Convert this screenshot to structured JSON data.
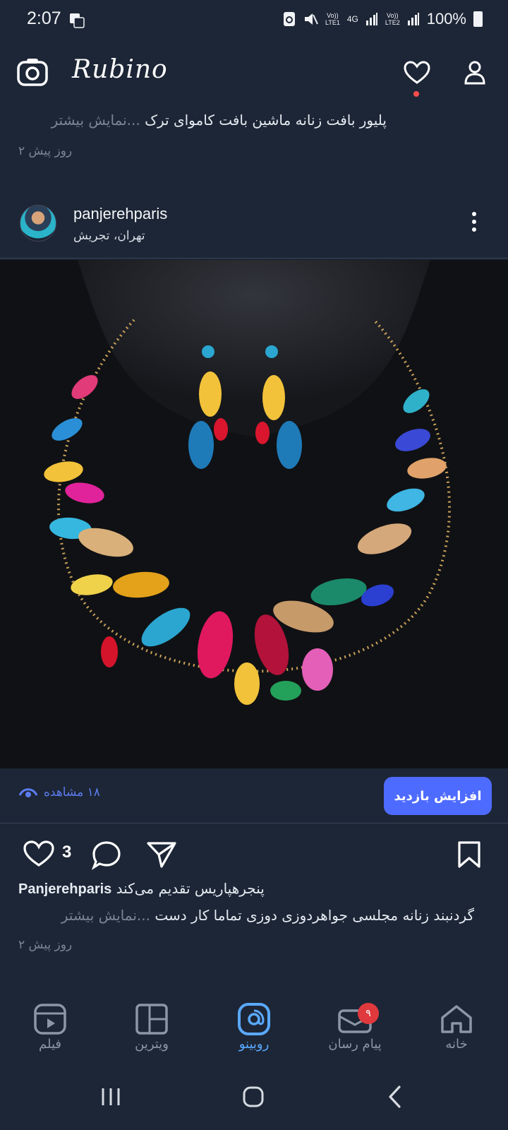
{
  "status": {
    "time": "2:07",
    "sim1_top": "Vo))",
    "sim1_bottom": "LTE1",
    "net": "4G",
    "sim2_top": "Vo))",
    "sim2_bottom": "LTE2",
    "battery": "100%"
  },
  "app": {
    "title": "Rubino"
  },
  "prev_post": {
    "caption": "پلیور بافت زنانه ماشین بافت کاموای ترک",
    "more": "...نمایش بیشتر",
    "time": "۲ روز پیش"
  },
  "post": {
    "username": "panjerehparis",
    "location": "تهران، تجریش",
    "views": "۱۸ مشاهده",
    "boost_label": "افزایش بازدید",
    "likes": "3",
    "caption_user": "Panjerehparis",
    "caption_intro": "پنجرهپاریس تقدیم می‌کند",
    "caption": "گردنبند زنانه مجلسی جواهردوزی دوزی تماما کار دست",
    "more": "...نمایش بیشتر",
    "time": "۲ روز پیش"
  },
  "nav": {
    "film": "فیلم",
    "vitrin": "ویترین",
    "rubino": "روبینو",
    "messenger": "پیام رسان",
    "messenger_badge": "۹",
    "home": "خانه"
  },
  "colors": {
    "background": "#1d2636",
    "accent": "#4e6bff",
    "active_tab": "#5aa9ff",
    "badge": "#e0393d"
  }
}
